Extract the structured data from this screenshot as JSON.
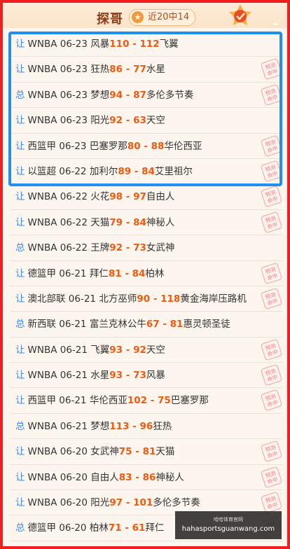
{
  "header": {
    "title": "探哥",
    "badge": "近20中14",
    "badge_icon": "star-icon"
  },
  "colors": {
    "border": "#f01e1e",
    "highlight": "#1f8ff0",
    "score": "#f0590e",
    "tag": "#3a8be8"
  },
  "rows": [
    {
      "tag": "让",
      "league": "WNBA",
      "date": "06-23",
      "home": "风暴",
      "hs": "110",
      "as": "112",
      "away": "飞翼",
      "hit": false
    },
    {
      "tag": "让",
      "league": "WNBA",
      "date": "06-23",
      "home": "狂热",
      "hs": "86",
      "as": "77",
      "away": "水星",
      "hit": true
    },
    {
      "tag": "总",
      "league": "WNBA",
      "date": "06-23",
      "home": "梦想",
      "hs": "94",
      "as": "87",
      "away": "多伦多节奏",
      "hit": true
    },
    {
      "tag": "让",
      "league": "WNBA",
      "date": "06-23",
      "home": "阳光",
      "hs": "92",
      "as": "63",
      "away": "天空",
      "hit": false
    },
    {
      "tag": "让",
      "league": "西篮甲",
      "date": "06-23",
      "home": "巴塞罗那",
      "hs": "80",
      "as": "88",
      "away": "华伦西亚",
      "hit": true
    },
    {
      "tag": "让",
      "league": "以篮超",
      "date": "06-22",
      "home": "加利尔",
      "hs": "89",
      "as": "84",
      "away": "艾里祖尔",
      "hit": true
    },
    {
      "tag": "让",
      "league": "WNBA",
      "date": "06-22",
      "home": "火花",
      "hs": "98",
      "as": "97",
      "away": "自由人",
      "hit": true
    },
    {
      "tag": "让",
      "league": "WNBA",
      "date": "06-22",
      "home": "天猫",
      "hs": "79",
      "as": "84",
      "away": "神秘人",
      "hit": true
    },
    {
      "tag": "总",
      "league": "WNBA",
      "date": "06-22",
      "home": "王牌",
      "hs": "92",
      "as": "73",
      "away": "女武神",
      "hit": false
    },
    {
      "tag": "让",
      "league": "德篮甲",
      "date": "06-21",
      "home": "拜仁",
      "hs": "81",
      "as": "84",
      "away": "柏林",
      "hit": true
    },
    {
      "tag": "让",
      "league": "澳北部联",
      "date": "06-21",
      "home": "北方巫师",
      "hs": "90",
      "as": "118",
      "away": "黄金海岸压路机",
      "hit": true
    },
    {
      "tag": "总",
      "league": "新西联",
      "date": "06-21",
      "home": "富兰克林公牛",
      "hs": "67",
      "as": "81",
      "away": "惠灵顿圣徒",
      "hit": false
    },
    {
      "tag": "让",
      "league": "WNBA",
      "date": "06-21",
      "home": "飞翼",
      "hs": "93",
      "as": "92",
      "away": "天空",
      "hit": true
    },
    {
      "tag": "让",
      "league": "WNBA",
      "date": "06-21",
      "home": "水星",
      "hs": "93",
      "as": "73",
      "away": "风暴",
      "hit": true
    },
    {
      "tag": "让",
      "league": "西篮甲",
      "date": "06-21",
      "home": "华伦西亚",
      "hs": "102",
      "as": "75",
      "away": "巴塞罗那",
      "hit": true
    },
    {
      "tag": "总",
      "league": "WNBA",
      "date": "06-21",
      "home": "梦想",
      "hs": "113",
      "as": "96",
      "away": "狂热",
      "hit": false
    },
    {
      "tag": "让",
      "league": "WNBA",
      "date": "06-20",
      "home": "女武神",
      "hs": "75",
      "as": "81",
      "away": "天猫",
      "hit": true
    },
    {
      "tag": "让",
      "league": "WNBA",
      "date": "06-20",
      "home": "自由人",
      "hs": "83",
      "as": "86",
      "away": "神秘人",
      "hit": true
    },
    {
      "tag": "让",
      "league": "WNBA",
      "date": "06-20",
      "home": "阳光",
      "hs": "97",
      "as": "101",
      "away": "多伦多节奏",
      "hit": true
    },
    {
      "tag": "总",
      "league": "德篮甲",
      "date": "06-20",
      "home": "柏林",
      "hs": "71",
      "as": "61",
      "away": "拜仁",
      "hit": true
    }
  ],
  "stamp_text": "预测命中",
  "watermark": {
    "line1": "哈哈体育官网",
    "line2": "hahasportsguanwang.com"
  }
}
